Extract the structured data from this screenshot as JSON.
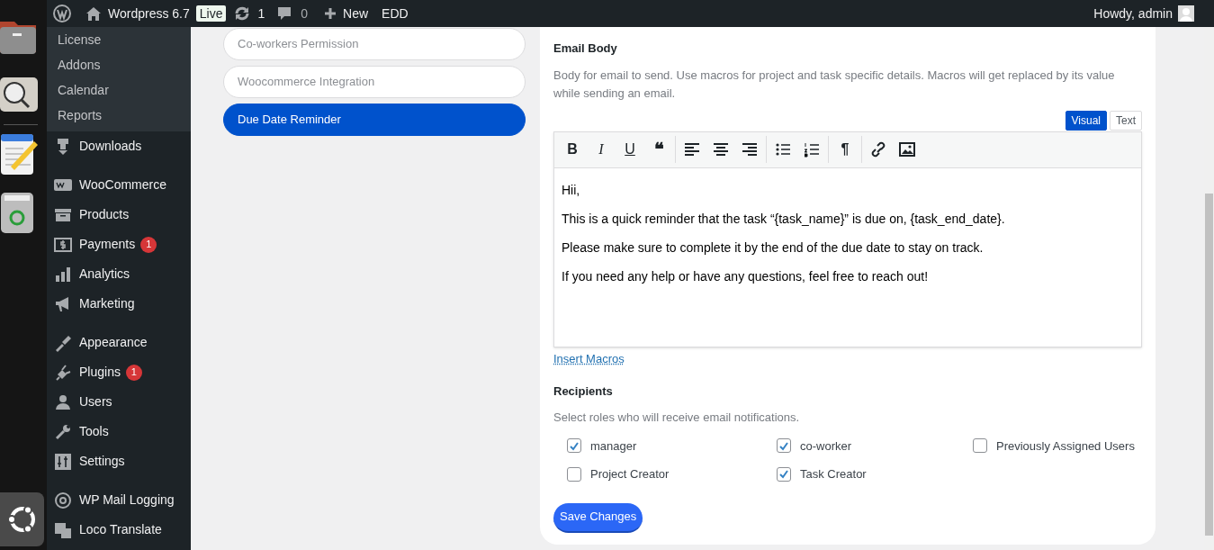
{
  "admin_bar": {
    "site": "Wordpress 6.7",
    "live_badge": "Live",
    "updates": "1",
    "comments": "0",
    "new": "New",
    "edd": "EDD",
    "greeting": "Howdy, admin"
  },
  "sidebar": {
    "submenu": [
      "License",
      "Addons",
      "Calendar",
      "Reports"
    ],
    "groups": [
      [
        {
          "label": "Downloads"
        }
      ],
      [
        {
          "label": "WooCommerce"
        },
        {
          "label": "Products"
        },
        {
          "label": "Payments",
          "badge": "1"
        },
        {
          "label": "Analytics"
        },
        {
          "label": "Marketing"
        }
      ],
      [
        {
          "label": "Appearance"
        },
        {
          "label": "Plugins",
          "badge": "1"
        },
        {
          "label": "Users"
        },
        {
          "label": "Tools"
        },
        {
          "label": "Settings"
        }
      ],
      [
        {
          "label": "WP Mail Logging"
        },
        {
          "label": "Loco Translate"
        }
      ]
    ]
  },
  "settings_nav": [
    {
      "label": "Co-workers Permission",
      "selected": false
    },
    {
      "label": "Woocommerce Integration",
      "selected": false
    },
    {
      "label": "Due Date Reminder",
      "selected": true
    }
  ],
  "email_body": {
    "title": "Email Body",
    "description": "Body for email to send. Use macros for project and task specific details. Macros will get replaced by its value while sending an email.",
    "editor_tabs": [
      {
        "label": "Visual",
        "selected": true
      },
      {
        "label": "Text",
        "selected": false
      }
    ],
    "toolbar": [
      {
        "kind": "char",
        "char": "B"
      },
      {
        "kind": "char",
        "char": "I"
      },
      {
        "kind": "char",
        "char": "U"
      },
      {
        "kind": "char",
        "char": "❝"
      },
      {
        "kind": "sep"
      },
      {
        "kind": "align-left"
      },
      {
        "kind": "align-center"
      },
      {
        "kind": "align-right"
      },
      {
        "kind": "sep"
      },
      {
        "kind": "bullets"
      },
      {
        "kind": "numbers"
      },
      {
        "kind": "sep"
      },
      {
        "kind": "char",
        "char": "¶"
      },
      {
        "kind": "sep"
      },
      {
        "kind": "link"
      },
      {
        "kind": "image"
      }
    ],
    "paragraphs": [
      "Hii,",
      "This is a quick reminder that the task “{task_name}” is due on, {task_end_date}.",
      "Please make sure to complete it by the end of the due date to stay on track.",
      "If you need any help or have any questions, feel free to reach out!"
    ],
    "insert_macros": "Insert Macros"
  },
  "recipients": {
    "title": "Recipients",
    "description": "Select roles who will receive email notifications.",
    "options": [
      {
        "label": "manager",
        "checked": true
      },
      {
        "label": "co-worker",
        "checked": true
      },
      {
        "label": "Previously Assigned Users",
        "checked": false
      },
      {
        "label": "Project Creator",
        "checked": false
      },
      {
        "label": "Task Creator",
        "checked": true
      }
    ]
  },
  "save_button": "Save Changes"
}
